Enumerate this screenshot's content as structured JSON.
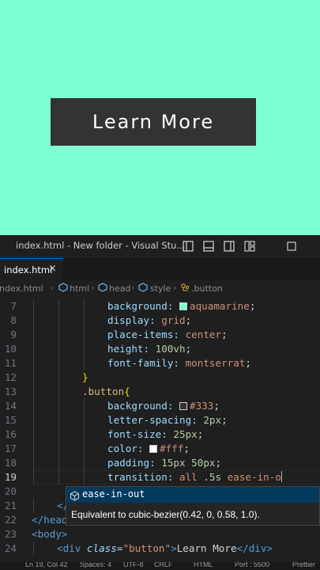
{
  "preview": {
    "button_label": "Learn More"
  },
  "window": {
    "title": "index.html - New folder - Visual Stu..."
  },
  "tab": {
    "label": "index.html",
    "close": "×"
  },
  "breadcrumb": [
    "index.html",
    "html",
    "head",
    "style",
    ".button"
  ],
  "editor": {
    "lines": [
      {
        "n": "7",
        "tokens": [
          [
            "prop",
            "background: "
          ],
          [
            "swatch",
            "#7fffd4"
          ],
          [
            "val",
            "aquamarine"
          ],
          [
            "punc",
            ";"
          ]
        ],
        "indent": 3
      },
      {
        "n": "8",
        "tokens": [
          [
            "prop",
            "display: "
          ],
          [
            "val",
            "grid"
          ],
          [
            "punc",
            ";"
          ]
        ],
        "indent": 3
      },
      {
        "n": "9",
        "tokens": [
          [
            "prop",
            "place-items: "
          ],
          [
            "val",
            "center"
          ],
          [
            "punc",
            ";"
          ]
        ],
        "indent": 3
      },
      {
        "n": "10",
        "tokens": [
          [
            "prop",
            "height: "
          ],
          [
            "num",
            "100vh"
          ],
          [
            "punc",
            ";"
          ]
        ],
        "indent": 3
      },
      {
        "n": "11",
        "tokens": [
          [
            "prop",
            "font-family: "
          ],
          [
            "val",
            "montserrat"
          ],
          [
            "punc",
            ";"
          ]
        ],
        "indent": 3
      },
      {
        "n": "12",
        "tokens": [
          [
            "brace",
            "}"
          ]
        ],
        "indent": 2
      },
      {
        "n": "13",
        "tokens": [
          [
            "sel",
            ".button"
          ],
          [
            "brace",
            "{"
          ]
        ],
        "indent": 2
      },
      {
        "n": "14",
        "tokens": [
          [
            "prop",
            "background: "
          ],
          [
            "swatch",
            "#333333"
          ],
          [
            "val",
            "#333"
          ],
          [
            "punc",
            ";"
          ]
        ],
        "indent": 3
      },
      {
        "n": "15",
        "tokens": [
          [
            "prop",
            "letter-spacing: "
          ],
          [
            "num",
            "2px"
          ],
          [
            "punc",
            ";"
          ]
        ],
        "indent": 3
      },
      {
        "n": "16",
        "tokens": [
          [
            "prop",
            "font-size: "
          ],
          [
            "num",
            "25px"
          ],
          [
            "punc",
            ";"
          ]
        ],
        "indent": 3
      },
      {
        "n": "17",
        "tokens": [
          [
            "prop",
            "color: "
          ],
          [
            "swatch",
            "#ffffff"
          ],
          [
            "val",
            "#fff"
          ],
          [
            "punc",
            ";"
          ]
        ],
        "indent": 3
      },
      {
        "n": "18",
        "tokens": [
          [
            "prop",
            "padding: "
          ],
          [
            "num",
            "15px 50px"
          ],
          [
            "punc",
            ";"
          ]
        ],
        "indent": 3
      },
      {
        "n": "19",
        "tokens": [
          [
            "prop",
            "transition: "
          ],
          [
            "val",
            "all "
          ],
          [
            "num",
            ".5s "
          ],
          [
            "val",
            "ease-in-o"
          ],
          [
            "cursor",
            ""
          ]
        ],
        "indent": 3,
        "current": true
      },
      {
        "n": "20",
        "tokens": [],
        "indent": 0
      },
      {
        "n": "21",
        "tokens": [
          [
            "tag",
            "</"
          ]
        ],
        "indent": 1
      },
      {
        "n": "22",
        "tokens": [
          [
            "tag",
            "</head"
          ]
        ],
        "indent": 0
      },
      {
        "n": "23",
        "tokens": [
          [
            "tag",
            "<body>"
          ]
        ],
        "indent": 0
      },
      {
        "n": "24",
        "tokens": [
          [
            "tag",
            "<div "
          ],
          [
            "attr",
            "class"
          ],
          [
            "text",
            "="
          ],
          [
            "val",
            "\"button\""
          ],
          [
            "tag",
            ">"
          ],
          [
            "text",
            "Learn More"
          ],
          [
            "tag",
            "</div>"
          ]
        ],
        "indent": 1
      }
    ]
  },
  "suggest": {
    "item": "ease-in-out",
    "detail": "Equivalent to cubic-bezier(0.42, 0, 0.58, 1.0)."
  },
  "statusbar": [
    "Ln 19, Col 42",
    "Spaces: 4",
    "UTF-8",
    "CRLF",
    "HTML",
    "Port : 5500",
    "Prettier"
  ],
  "colors": {
    "preview_bg": "#7fffd4",
    "button_bg": "#333333",
    "accent": "#0078d4"
  },
  "icons": [
    "toggle-primary-sidebar-icon",
    "toggle-panel-icon",
    "toggle-secondary-sidebar-icon",
    "customize-layout-icon",
    "maximize-icon"
  ]
}
